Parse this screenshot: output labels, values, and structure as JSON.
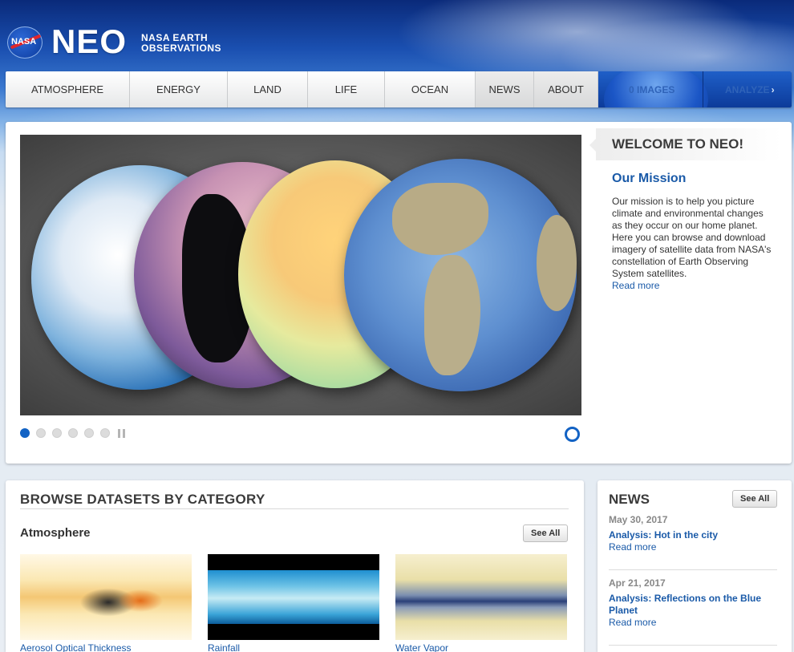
{
  "header": {
    "logo_text": "NASA",
    "site_name": "NEO",
    "subtitle_line1": "NASA EARTH",
    "subtitle_line2": "OBSERVATIONS"
  },
  "nav": {
    "items": [
      "Atmosphere",
      "Energy",
      "Land",
      "Life",
      "Ocean",
      "News",
      "About"
    ],
    "images_label": "0 IMAGES",
    "analyze_label": "ANALYZE"
  },
  "carousel": {
    "dot_count": 6,
    "active_index": 0
  },
  "welcome": {
    "title": "WELCOME TO NEO!",
    "mission_heading": "Our Mission",
    "mission_text": "Our mission is to help you picture climate and environmental changes as they occur on our home planet. Here you can browse and download imagery of satellite data from NASA's constellation of Earth Observing System satellites.",
    "read_more": "Read more"
  },
  "browse": {
    "title": "BROWSE DATASETS BY CATEGORY",
    "category": "Atmosphere",
    "see_all": "See All",
    "datasets": [
      {
        "label": "Aerosol Optical Thickness"
      },
      {
        "label": "Rainfall"
      },
      {
        "label": "Water Vapor"
      }
    ]
  },
  "news": {
    "title": "NEWS",
    "see_all": "See All",
    "items": [
      {
        "date": "May 30, 2017",
        "headline": "Analysis: Hot in the city",
        "more": "Read more"
      },
      {
        "date": "Apr 21, 2017",
        "headline": "Analysis: Reflections on the Blue Planet",
        "more": "Read more"
      }
    ]
  },
  "colors": {
    "accent_blue": "#1a5aa8",
    "active_dot": "#1262c4",
    "nav_dark": "#0c3b9a"
  }
}
